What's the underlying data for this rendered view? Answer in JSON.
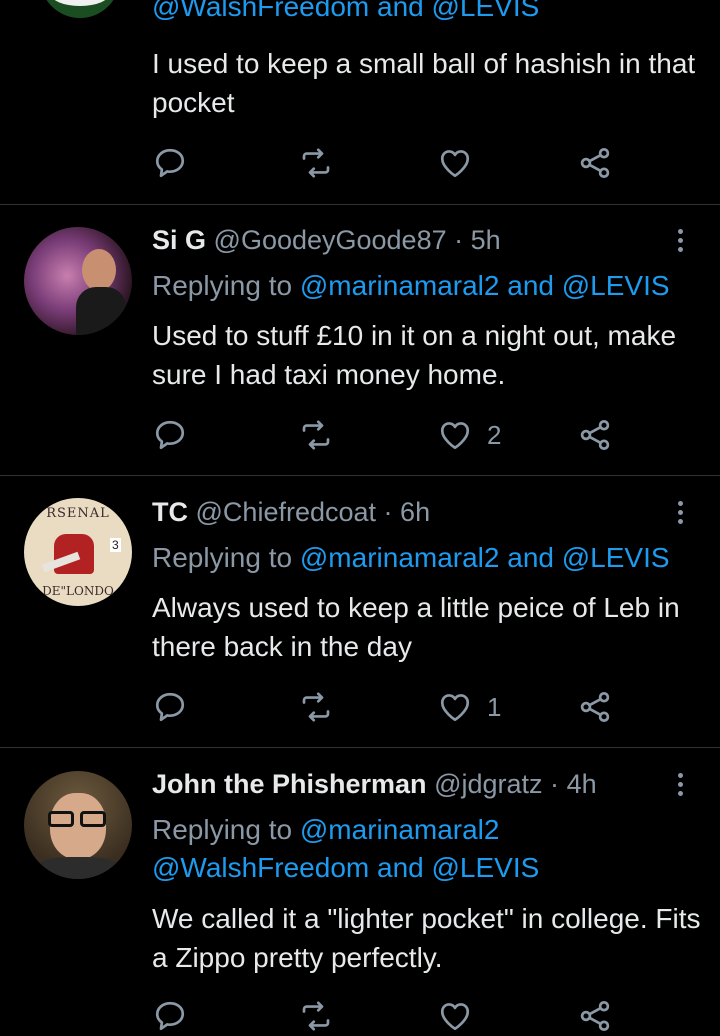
{
  "colors": {
    "background": "#000000",
    "link": "#1d9bf0",
    "muted": "#8b98a5",
    "text": "#e7e9ea",
    "divider": "#2f3336"
  },
  "tweets": [
    {
      "partial_reply_line": "@WalshFreedom and @LEVIS",
      "text": "I used to keep a small ball of hashish in that pocket",
      "likes": ""
    },
    {
      "name": "Si G",
      "handle": "@GoodeyGoode87",
      "time": "5h",
      "reply_prefix": "Replying to",
      "reply_line1": "@marinamaral2 and @LEVIS",
      "text": "Used to stuff £10 in it on a night out, make sure I had taxi money home.",
      "likes": "2"
    },
    {
      "name": "TC",
      "handle": "@Chiefredcoat",
      "time": "6h",
      "reply_prefix": "Replying to",
      "reply_line1": "@marinamaral2 and @LEVIS",
      "avatar_text": {
        "top": "RSENAL",
        "bottom": "DE\"LONDO",
        "number": "3"
      },
      "text": "Always used to keep a little peice of Leb in there back in the day",
      "likes": "1"
    },
    {
      "name": "John the Phisherman",
      "handle": "@jdgratz",
      "time": "4h",
      "reply_prefix": "Replying to",
      "reply_line1": "@marinamaral2",
      "reply_line2": "@WalshFreedom and @LEVIS",
      "text": "We called it a \"lighter pocket\" in college. Fits a Zippo pretty perfectly.",
      "likes": ""
    }
  ],
  "sep": "·",
  "icons": [
    "reply-icon",
    "retweet-icon",
    "like-icon",
    "share-icon",
    "more-icon"
  ]
}
